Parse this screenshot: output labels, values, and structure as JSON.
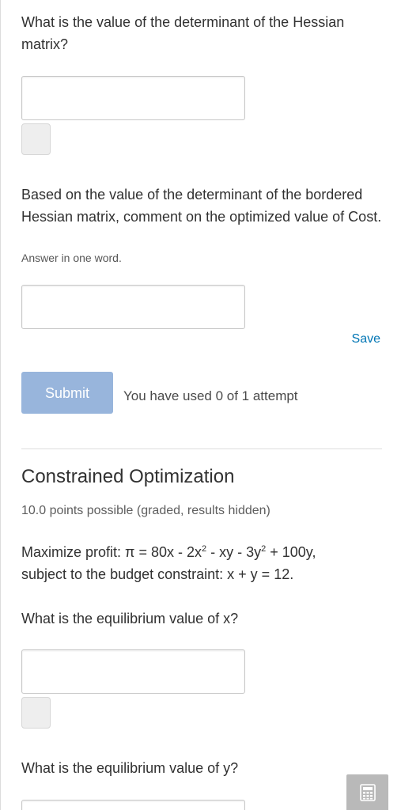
{
  "q1": {
    "text": "What is the value of the determinant of the Hessian matrix?",
    "value": ""
  },
  "q2": {
    "text": "Based on the value of the determinant of the bordered Hessian matrix, comment on the optimized value of Cost.",
    "hint": "Answer in one word.",
    "value": ""
  },
  "actions": {
    "save_label": "Save",
    "submit_label": "Submit",
    "attempts_text": "You have used 0 of 1 attempt"
  },
  "section": {
    "title": "Constrained Optimization",
    "points": "10.0 points possible (graded, results hidden)",
    "problem": {
      "p1": "Maximize profit: π = 80x - 2x",
      "s1": "2",
      "p2": " - xy - 3y",
      "s2": "2",
      "p3": " + 100y,",
      "line2": "subject to the budget constraint: x + y = 12."
    },
    "q_x": {
      "text": "What is the equilibrium value of x?",
      "value": ""
    },
    "q_y": {
      "text": "What is the equilibrium value of y?",
      "value": ""
    }
  },
  "colors": {
    "accent": "#0075b4",
    "submit_disabled": "#98b5dc",
    "calculator_bg": "#b9b9b9"
  },
  "icons": {
    "calculator": "calculator-icon"
  }
}
